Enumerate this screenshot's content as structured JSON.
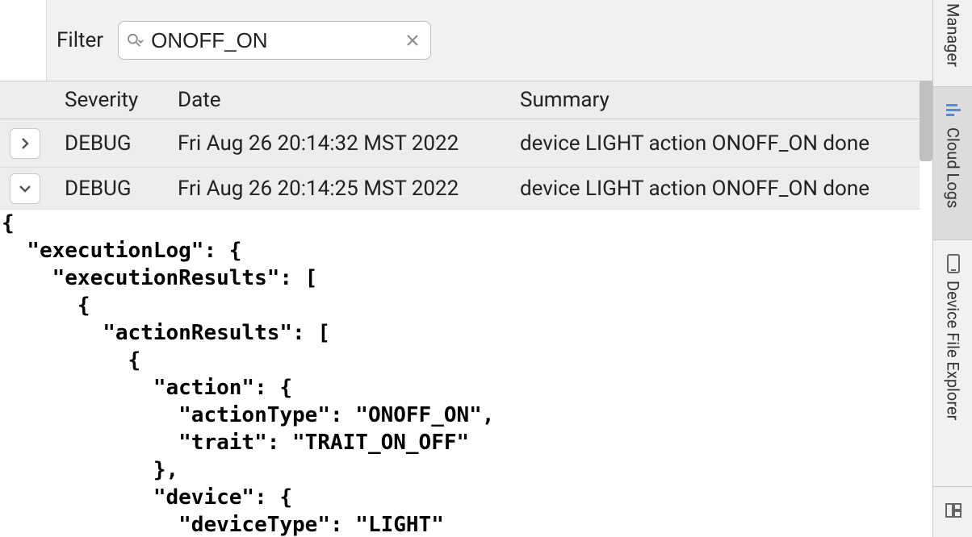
{
  "filter": {
    "label": "Filter",
    "value": "ONOFF_ON"
  },
  "columns": {
    "severity": "Severity",
    "date": "Date",
    "summary": "Summary"
  },
  "rows": [
    {
      "severity": "DEBUG",
      "date": "Fri Aug 26 20:14:32 MST 2022",
      "summary": "device LIGHT action ONOFF_ON done"
    },
    {
      "severity": "DEBUG",
      "date": "Fri Aug 26 20:14:25 MST 2022",
      "summary": "device LIGHT action ONOFF_ON done"
    }
  ],
  "json_detail": "{\n  \"executionLog\": {\n    \"executionResults\": [\n      {\n        \"actionResults\": [\n          {\n            \"action\": {\n              \"actionType\": \"ONOFF_ON\",\n              \"trait\": \"TRAIT_ON_OFF\"\n            },\n            \"device\": {\n              \"deviceType\": \"LIGHT\"",
  "side_tabs": {
    "manager": "Manager",
    "cloud_logs": "Cloud Logs",
    "device_file_explorer": "Device File Explorer"
  }
}
